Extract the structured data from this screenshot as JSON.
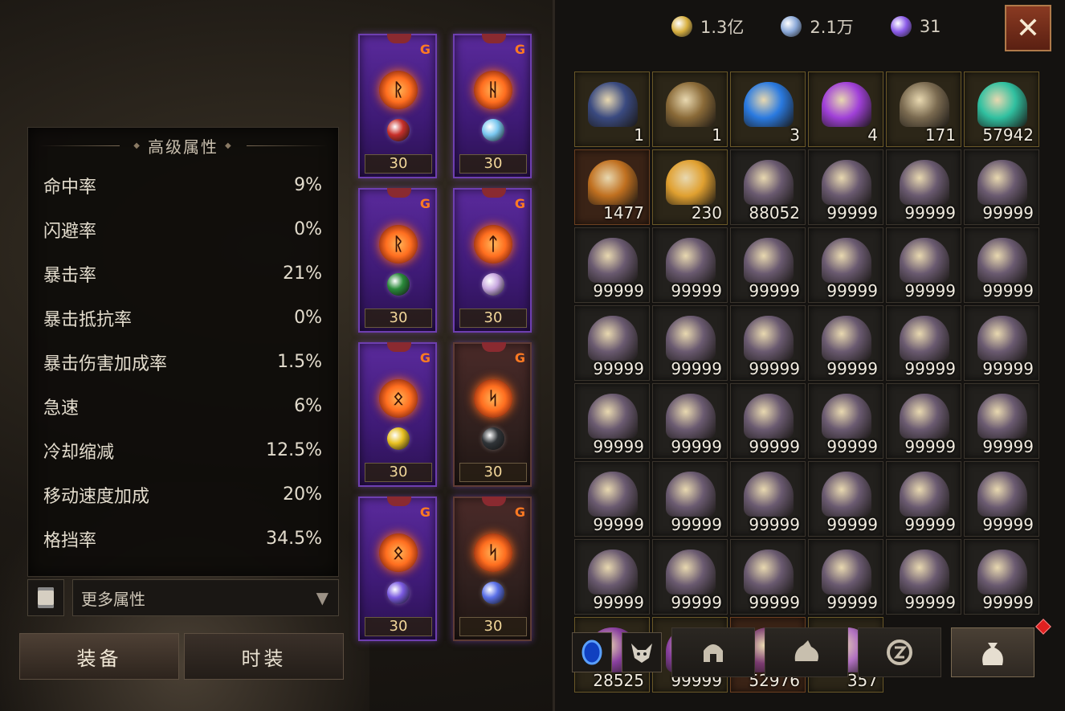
{
  "stats": {
    "title": "高级属性",
    "rows": [
      {
        "label": "命中率",
        "value": "9%"
      },
      {
        "label": "闪避率",
        "value": "0%"
      },
      {
        "label": "暴击率",
        "value": "21%"
      },
      {
        "label": "暴击抵抗率",
        "value": "0%"
      },
      {
        "label": "暴击伤害加成率",
        "value": "1.5%"
      },
      {
        "label": "急速",
        "value": "6%"
      },
      {
        "label": "冷却缩减",
        "value": "12.5%"
      },
      {
        "label": "移动速度加成",
        "value": "20%"
      },
      {
        "label": "格挡率",
        "value": "34.5%"
      }
    ],
    "more_label": "更多属性"
  },
  "tabs": {
    "equip": "装备",
    "fashion": "时装"
  },
  "equipment": [
    {
      "level": "30",
      "rune": "ᚱ",
      "gem_color": "#c8302a",
      "dark": false
    },
    {
      "level": "30",
      "rune": "ᚺ",
      "gem_color": "#7ac8f0",
      "dark": false
    },
    {
      "level": "30",
      "rune": "ᚱ",
      "gem_color": "#2a8a3a",
      "dark": false
    },
    {
      "level": "30",
      "rune": "ᛏ",
      "gem_color": "#c8a8e0",
      "dark": false
    },
    {
      "level": "30",
      "rune": "ᛟ",
      "gem_color": "#e8c020",
      "dark": false
    },
    {
      "level": "30",
      "rune": "ᛋ",
      "gem_color": "#303438",
      "dark": true
    },
    {
      "level": "30",
      "rune": "ᛟ",
      "gem_color": "#7a5ae0",
      "dark": false
    },
    {
      "level": "30",
      "rune": "ᛋ",
      "gem_color": "#5a70e8",
      "dark": true
    }
  ],
  "currency": [
    {
      "icon": "gold-coin-icon",
      "value": "1.3亿",
      "color": "#d8b040"
    },
    {
      "icon": "crystal-card-icon",
      "value": "2.1万",
      "color": "#8aa8d8"
    },
    {
      "icon": "purple-orb-icon",
      "value": "31",
      "color": "#8a5ae8"
    }
  ],
  "inventory": [
    {
      "qty": "1",
      "style": "gold",
      "icon": "#3a4a80"
    },
    {
      "qty": "1",
      "style": "gold",
      "icon": "#8a6a38"
    },
    {
      "qty": "3",
      "style": "gold",
      "icon": "#2a7ae0"
    },
    {
      "qty": "4",
      "style": "gold",
      "icon": "#a040d8"
    },
    {
      "qty": "171",
      "style": "gold",
      "icon": "#7a6a50"
    },
    {
      "qty": "57942",
      "style": "gold",
      "icon": "#30c0a0"
    },
    {
      "qty": "1477",
      "style": "orange",
      "icon": "#c07020"
    },
    {
      "qty": "230",
      "style": "gold",
      "icon": "#e0a030"
    },
    {
      "qty": "88052",
      "style": "",
      "icon": "#6a5a70"
    },
    {
      "qty": "99999",
      "style": "",
      "icon": "#6a5a70"
    },
    {
      "qty": "99999",
      "style": "",
      "icon": "#6a5a70"
    },
    {
      "qty": "99999",
      "style": "",
      "icon": "#6a5a70"
    },
    {
      "qty": "99999",
      "style": "",
      "icon": "#6a5a70"
    },
    {
      "qty": "99999",
      "style": "",
      "icon": "#6a5a70"
    },
    {
      "qty": "99999",
      "style": "",
      "icon": "#6a5a70"
    },
    {
      "qty": "99999",
      "style": "",
      "icon": "#6a5a70"
    },
    {
      "qty": "99999",
      "style": "",
      "icon": "#6a5a70"
    },
    {
      "qty": "99999",
      "style": "",
      "icon": "#6a5a70"
    },
    {
      "qty": "99999",
      "style": "",
      "icon": "#6a5a70"
    },
    {
      "qty": "99999",
      "style": "",
      "icon": "#6a5a70"
    },
    {
      "qty": "99999",
      "style": "",
      "icon": "#6a5a70"
    },
    {
      "qty": "99999",
      "style": "",
      "icon": "#6a5a70"
    },
    {
      "qty": "99999",
      "style": "",
      "icon": "#6a5a70"
    },
    {
      "qty": "99999",
      "style": "",
      "icon": "#6a5a70"
    },
    {
      "qty": "99999",
      "style": "",
      "icon": "#6a5a70"
    },
    {
      "qty": "99999",
      "style": "",
      "icon": "#6a5a70"
    },
    {
      "qty": "99999",
      "style": "",
      "icon": "#6a5a70"
    },
    {
      "qty": "99999",
      "style": "",
      "icon": "#6a5a70"
    },
    {
      "qty": "99999",
      "style": "",
      "icon": "#6a5a70"
    },
    {
      "qty": "99999",
      "style": "",
      "icon": "#6a5a70"
    },
    {
      "qty": "99999",
      "style": "",
      "icon": "#6a5a70"
    },
    {
      "qty": "99999",
      "style": "",
      "icon": "#6a5a70"
    },
    {
      "qty": "99999",
      "style": "",
      "icon": "#6a5a70"
    },
    {
      "qty": "99999",
      "style": "",
      "icon": "#6a5a70"
    },
    {
      "qty": "99999",
      "style": "",
      "icon": "#6a5a70"
    },
    {
      "qty": "99999",
      "style": "",
      "icon": "#6a5a70"
    },
    {
      "qty": "99999",
      "style": "",
      "icon": "#6a5a70"
    },
    {
      "qty": "99999",
      "style": "",
      "icon": "#6a5a70"
    },
    {
      "qty": "99999",
      "style": "",
      "icon": "#6a5a70"
    },
    {
      "qty": "99999",
      "style": "",
      "icon": "#6a5a70"
    },
    {
      "qty": "99999",
      "style": "",
      "icon": "#6a5a70"
    },
    {
      "qty": "99999",
      "style": "",
      "icon": "#6a5a70"
    },
    {
      "qty": "28525",
      "style": "gold",
      "icon": "#8a40a0"
    },
    {
      "qty": "99999",
      "style": "gold",
      "icon": "#8a40a0"
    },
    {
      "qty": "52976",
      "style": "orange",
      "icon": "#7a3a70"
    },
    {
      "qty": "357",
      "style": "gold",
      "icon": "#b070c0"
    }
  ],
  "bottom_tabs": [
    "portal-icon",
    "demon-head-icon",
    "helmet-icon",
    "pouch-icon",
    "rune-icon",
    "bag-icon"
  ]
}
